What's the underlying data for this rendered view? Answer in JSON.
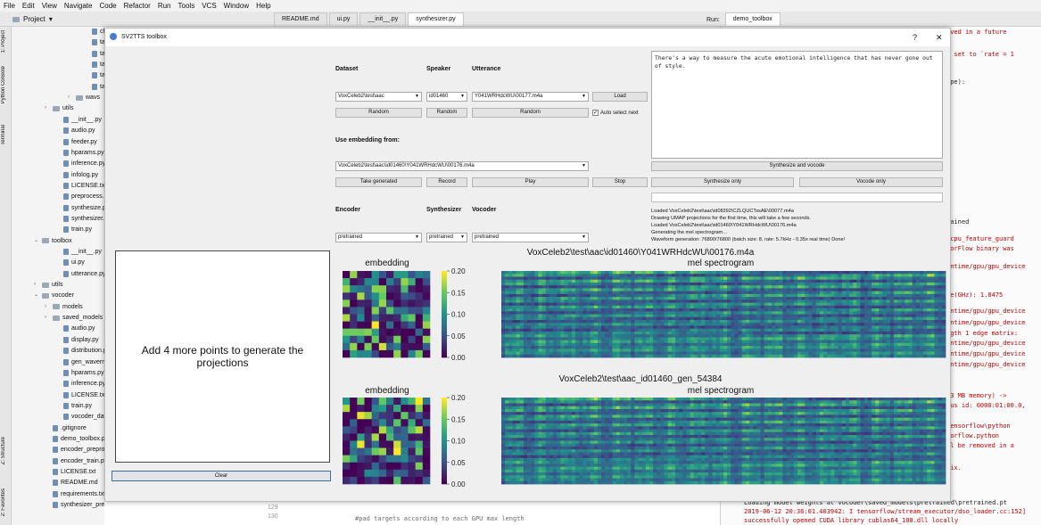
{
  "menu": [
    "File",
    "Edit",
    "View",
    "Navigate",
    "Code",
    "Refactor",
    "Run",
    "Tools",
    "VCS",
    "Window",
    "Help"
  ],
  "project_header": "Project",
  "editor_tabs": [
    "README.md",
    "ui.py",
    "__init__.py",
    "synthesizer.py"
  ],
  "run_label": "Run:",
  "run_tab": "demo_toolbox",
  "side_labels": {
    "project": "1: Project",
    "python_console": "Python Console",
    "terminal": "Terminal",
    "structure": "Z: Structure",
    "favorites": "2: Favorites"
  },
  "tree": [
    {
      "name": "chec",
      "kind": "file",
      "indent": 80
    },
    {
      "name": "tacot",
      "kind": "file",
      "indent": 80
    },
    {
      "name": "tacot",
      "kind": "file",
      "indent": 80
    },
    {
      "name": "tacot",
      "kind": "file",
      "indent": 80
    },
    {
      "name": "tacot",
      "kind": "file",
      "indent": 80
    },
    {
      "name": "tacot",
      "kind": "file",
      "indent": 80
    },
    {
      "name": "wavs",
      "kind": "folder",
      "indent": 62,
      "tw": "›"
    },
    {
      "name": "utils",
      "kind": "folder",
      "indent": 36,
      "tw": "›"
    },
    {
      "name": "__init__.py",
      "kind": "file",
      "indent": 48
    },
    {
      "name": "audio.py",
      "kind": "file",
      "indent": 48
    },
    {
      "name": "feeder.py",
      "kind": "file",
      "indent": 48
    },
    {
      "name": "hparams.py",
      "kind": "file",
      "indent": 48
    },
    {
      "name": "inference.py",
      "kind": "file",
      "indent": 48
    },
    {
      "name": "infolog.py",
      "kind": "file",
      "indent": 48
    },
    {
      "name": "LICENSE.txt",
      "kind": "file",
      "indent": 48
    },
    {
      "name": "preprocess.py",
      "kind": "file",
      "indent": 48
    },
    {
      "name": "synthesize.py",
      "kind": "file",
      "indent": 48
    },
    {
      "name": "synthesizer.py",
      "kind": "file",
      "indent": 48
    },
    {
      "name": "train.py",
      "kind": "file",
      "indent": 48
    },
    {
      "name": "toolbox",
      "kind": "folder",
      "indent": 24,
      "tw": "⌄"
    },
    {
      "name": "__init__.py",
      "kind": "file",
      "indent": 48
    },
    {
      "name": "ui.py",
      "kind": "file",
      "indent": 48
    },
    {
      "name": "utterance.py",
      "kind": "file",
      "indent": 48
    },
    {
      "name": "utils",
      "kind": "folder",
      "indent": 24,
      "tw": "›"
    },
    {
      "name": "vocoder",
      "kind": "folder",
      "indent": 24,
      "tw": "⌄"
    },
    {
      "name": "models",
      "kind": "folder",
      "indent": 36,
      "tw": "›"
    },
    {
      "name": "saved_models",
      "kind": "folder",
      "indent": 36,
      "tw": "›"
    },
    {
      "name": "audio.py",
      "kind": "file",
      "indent": 48
    },
    {
      "name": "display.py",
      "kind": "file",
      "indent": 48
    },
    {
      "name": "distribution.py",
      "kind": "file",
      "indent": 48
    },
    {
      "name": "gen_wavernn.py",
      "kind": "file",
      "indent": 48
    },
    {
      "name": "hparams.py",
      "kind": "file",
      "indent": 48
    },
    {
      "name": "inference.py",
      "kind": "file",
      "indent": 48
    },
    {
      "name": "LICENSE.txt",
      "kind": "file",
      "indent": 48
    },
    {
      "name": "train.py",
      "kind": "file",
      "indent": 48
    },
    {
      "name": "vocoder_dataset.",
      "kind": "file",
      "indent": 48
    },
    {
      "name": ".gitignore",
      "kind": "file",
      "indent": 36
    },
    {
      "name": "demo_toolbox.py",
      "kind": "file",
      "indent": 36
    },
    {
      "name": "encoder_preprocess.",
      "kind": "file",
      "indent": 36
    },
    {
      "name": "encoder_train.py",
      "kind": "file",
      "indent": 36
    },
    {
      "name": "LICENSE.txt",
      "kind": "file",
      "indent": 36
    },
    {
      "name": "README.md",
      "kind": "file",
      "indent": 36
    },
    {
      "name": "requirements.txt",
      "kind": "file",
      "indent": 36
    },
    {
      "name": "synthesizer_preprocess_audio.py",
      "kind": "file",
      "indent": 36
    }
  ],
  "gutter": [
    "129",
    "130"
  ],
  "code_line": "#pad targets according to each GPU max length",
  "console_lines": [
    {
      "t": "oved in a future",
      "red": true
    },
    {
      "t": "e set to `rate = 1",
      "red": true
    },
    {
      "t": "ape):",
      "red": false
    },
    {
      "t": "rained",
      "red": false
    },
    {
      "t": "/cpu_feature_guard",
      "red": true
    },
    {
      "t": "sorFlow binary was",
      "red": true
    },
    {
      "t": "untime/gpu/gpu_device",
      "red": true
    },
    {
      "t": "te(GHz): 1.8475",
      "red": true
    },
    {
      "t": "untime/gpu/gpu_device",
      "red": true
    },
    {
      "t": "untime/gpu/gpu_device",
      "red": true
    },
    {
      "t": "ngth 1 edge matrix:",
      "red": true
    },
    {
      "t": "untime/gpu/gpu_device",
      "red": true
    },
    {
      "t": "untime/gpu/gpu_device",
      "red": true
    },
    {
      "t": "untime/gpu/gpu_device",
      "red": true
    },
    {
      "t": "53 MB memory) ->",
      "red": true
    },
    {
      "t": "bus id: 0000:01:00.0,",
      "red": true
    },
    {
      "t": "tensorflow\\python",
      "red": true
    },
    {
      "t": "sorflow.python",
      "red": true
    },
    {
      "t": "ll be removed in a",
      "red": true
    },
    {
      "t": "fix.",
      "red": true
    },
    {
      "t": "Loading model weights at vocoder\\saved_models\\pretrained\\pretrained.pt",
      "red": false
    },
    {
      "t": "2019-06-12 20:36:01.403942: I tensorflow/stream_executor/dso_loader.cc:152]",
      "red": true
    },
    {
      "t": "  successfully opened CUDA library cublas64_100.dll locally",
      "red": true
    }
  ],
  "window": {
    "title": "SV2TTS toolbox",
    "help": "?",
    "close": "✕"
  },
  "labels": {
    "dataset": "Dataset",
    "speaker": "Speaker",
    "utterance": "Utterance",
    "use_embedding": "Use embedding from:",
    "encoder": "Encoder",
    "synthesizer": "Synthesizer",
    "vocoder": "Vocoder"
  },
  "combos": {
    "dataset": "VoxCeleb2\\test\\aac",
    "speaker": "id01460",
    "utterance": "Y041WRHdcWU\\00177.m4a",
    "embedding": "VoxCeleb2\\test\\aac\\id01460\\Y041WRHdcWU\\00176.m4a",
    "encoder": "pretrained",
    "synthesizer": "pretrained",
    "vocoder": "pretrained"
  },
  "buttons": {
    "load": "Load",
    "random1": "Random",
    "random2": "Random",
    "random3": "Random",
    "take_generated": "Take generated",
    "record": "Record",
    "play": "Play",
    "stop": "Stop",
    "synth_vocode": "Synthesize and vocode",
    "synth_only": "Synthesize only",
    "vocode_only": "Vocode only",
    "clear": "Clear"
  },
  "auto_select": {
    "label": "Auto select next",
    "checked": true
  },
  "text_input": "There's a way to measure the acute emotional intelligence that has never gone out of style.",
  "log": [
    "Loaded VoxCeleb2\\test\\aac\\id08392\\CZLQUCTssAE\\00077.m4a",
    "Drawing UMAP projections for the first time, this will take a few seconds.",
    "Loaded VoxCeleb2\\test\\aac\\id01460\\Y041WRHdcWU\\00176.m4a",
    "Generating the mel spectrogram...",
    "Waveform generation: 76800/76800 (batch size: 8, rate: 5.7kHz - 0.35x real time) Done!"
  ],
  "projection_message": "Add 4 more points to generate the projections",
  "plots": [
    {
      "title": "VoxCeleb2\\test\\aac\\id01460\\Y041WRHdcWU\\00176.m4a",
      "embedding_label": "embedding",
      "mel_label": "mel spectrogram",
      "colorbar_ticks": [
        "0.20",
        "0.15",
        "0.10",
        "0.05",
        "0.00"
      ]
    },
    {
      "title": "VoxCeleb2\\test\\aac_id01460_gen_54384",
      "embedding_label": "embedding",
      "mel_label": "mel spectrogram",
      "colorbar_ticks": [
        "0.20",
        "0.15",
        "0.10",
        "0.05",
        "0.00"
      ]
    }
  ],
  "colors": {
    "viridis_dark": "#440154",
    "viridis_mid": "#21918c",
    "viridis_light": "#fde725",
    "accent": "#3a6ea5"
  }
}
